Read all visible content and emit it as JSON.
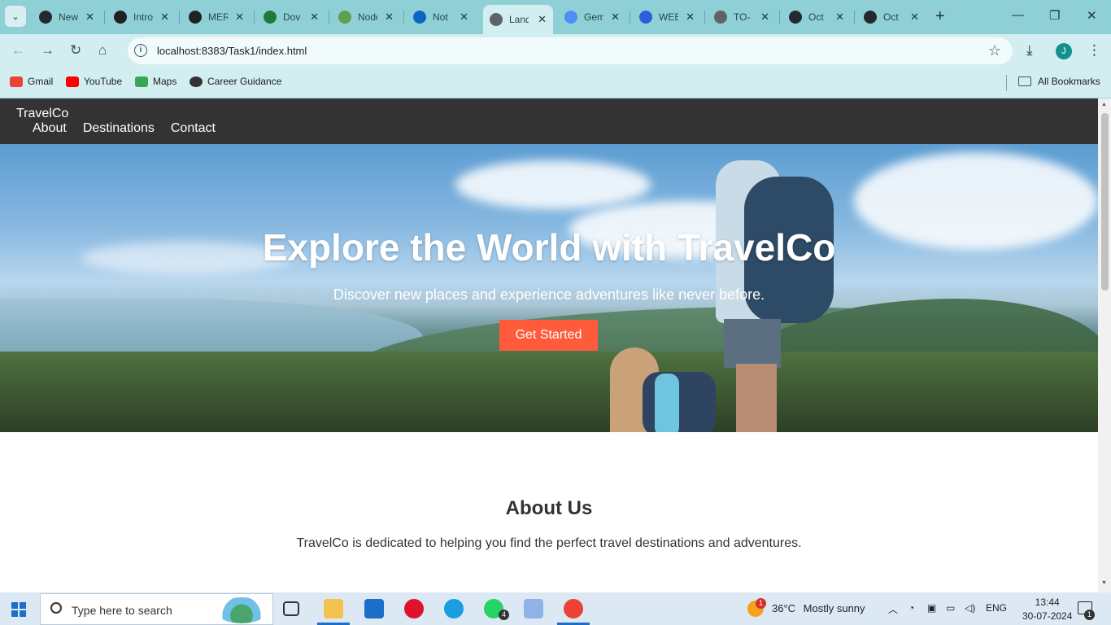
{
  "browser": {
    "tabs": [
      {
        "label": "New",
        "icon": "github-icon",
        "color": "#24292f"
      },
      {
        "label": "Intro",
        "icon": "chatgpt-icon",
        "color": "#202123"
      },
      {
        "label": "MERN",
        "icon": "chatgpt-icon",
        "color": "#202123"
      },
      {
        "label": "Dov",
        "icon": "mongodb-icon",
        "color": "#1f7a3a"
      },
      {
        "label": "Node",
        "icon": "nodejs-icon",
        "color": "#5fa04e"
      },
      {
        "label": "Not",
        "icon": "linkedin-icon",
        "color": "#0a66c2"
      },
      {
        "label": "Land",
        "icon": "globe-icon",
        "color": "#5f6368"
      },
      {
        "label": "Gem",
        "icon": "gemini-icon",
        "color": "#4c8df6"
      },
      {
        "label": "WEB",
        "icon": "edge-swirl-icon",
        "color": "#2b5fd9"
      },
      {
        "label": "TO-",
        "icon": "globe-icon",
        "color": "#5f6368"
      },
      {
        "label": "Oct",
        "icon": "github-icon",
        "color": "#24292f"
      },
      {
        "label": "Oct",
        "icon": "github-icon",
        "color": "#24292f"
      }
    ],
    "active_tab_index": 6,
    "url": "localhost:8383/Task1/index.html",
    "profile_initial": "J",
    "bookmarks": [
      {
        "label": "Gmail",
        "icon": "gmail-icon",
        "color": "#ea4335"
      },
      {
        "label": "YouTube",
        "icon": "youtube-icon",
        "color": "#ff0000"
      },
      {
        "label": "Maps",
        "icon": "maps-icon",
        "color": "#34a853"
      },
      {
        "label": "Career Guidance",
        "icon": "globe-icon",
        "color": "#333333"
      }
    ],
    "all_bookmarks_label": "All Bookmarks"
  },
  "site": {
    "brand": "TravelCo",
    "nav": [
      "About",
      "Destinations",
      "Contact"
    ],
    "hero": {
      "title": "Explore the World with TravelCo",
      "subtitle": "Discover new places and experience adventures like never before.",
      "cta": "Get Started",
      "cta_color": "#ff5b3a"
    },
    "about": {
      "title": "About Us",
      "text": "TravelCo is dedicated to helping you find the perfect travel destinations and adventures."
    },
    "header_color": "#333333"
  },
  "taskbar": {
    "search_placeholder": "Type here to search",
    "apps": [
      {
        "name": "task-view",
        "color": "#333333"
      },
      {
        "name": "file-explorer",
        "color": "#f2c14e"
      },
      {
        "name": "mail",
        "color": "#1c6fc9"
      },
      {
        "name": "opera",
        "color": "#e0112b"
      },
      {
        "name": "edge",
        "color": "#1b9de2"
      },
      {
        "name": "whatsapp",
        "color": "#25d366"
      },
      {
        "name": "netbeans",
        "color": "#8fb3e8"
      },
      {
        "name": "chrome",
        "color": "#ea4335"
      }
    ],
    "whatsapp_badge": "4",
    "weather_temp": "36°C",
    "weather_desc": "Mostly sunny",
    "weather_badge": "1",
    "language": "ENG",
    "time": "13:44",
    "date": "30-07-2024",
    "notification_count": "1"
  }
}
